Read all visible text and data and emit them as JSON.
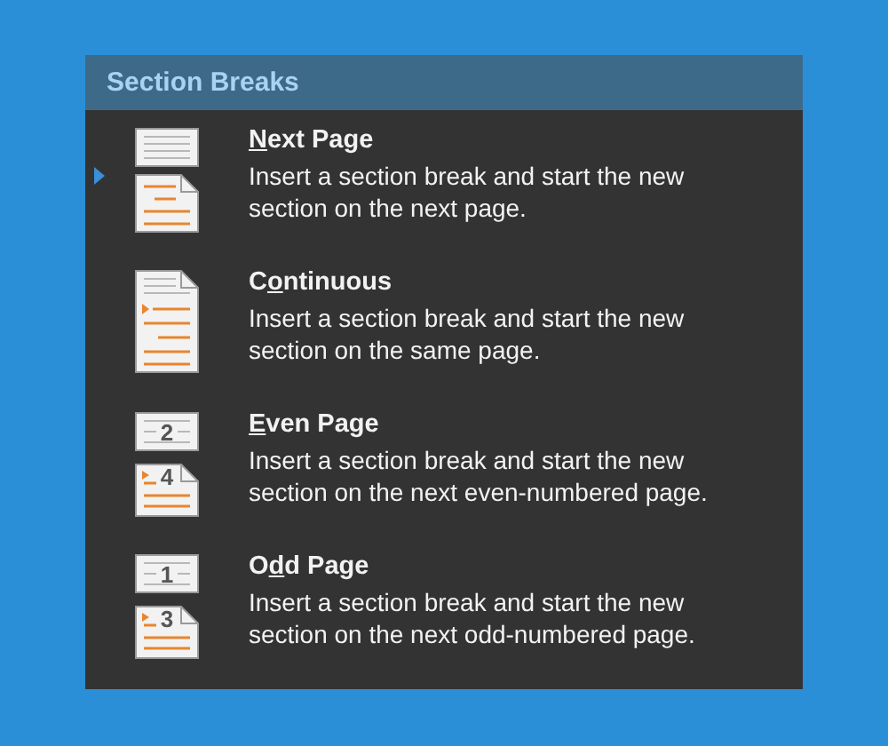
{
  "menu": {
    "title": "Section Breaks",
    "items": [
      {
        "kind": "next_page",
        "selected": true,
        "label_key": "N",
        "label_post": "ext Page",
        "description": "Insert a section break and start the new section on the next page."
      },
      {
        "kind": "continuous",
        "selected": false,
        "label_pre": "C",
        "label_key": "o",
        "label_post": "ntinuous",
        "description": "Insert a section break and start the new section on the same page."
      },
      {
        "kind": "even_page",
        "selected": false,
        "label_key": "E",
        "label_post": "ven Page",
        "description": "Insert a section break and start the new section on the next even-numbered page.",
        "icon_numbers": [
          "2",
          "4"
        ]
      },
      {
        "kind": "odd_page",
        "selected": false,
        "label_pre": "O",
        "label_key": "d",
        "label_post": "d Page",
        "description": "Insert a section break and start the new section on the next odd-numbered page.",
        "icon_numbers": [
          "1",
          "3"
        ]
      }
    ]
  }
}
